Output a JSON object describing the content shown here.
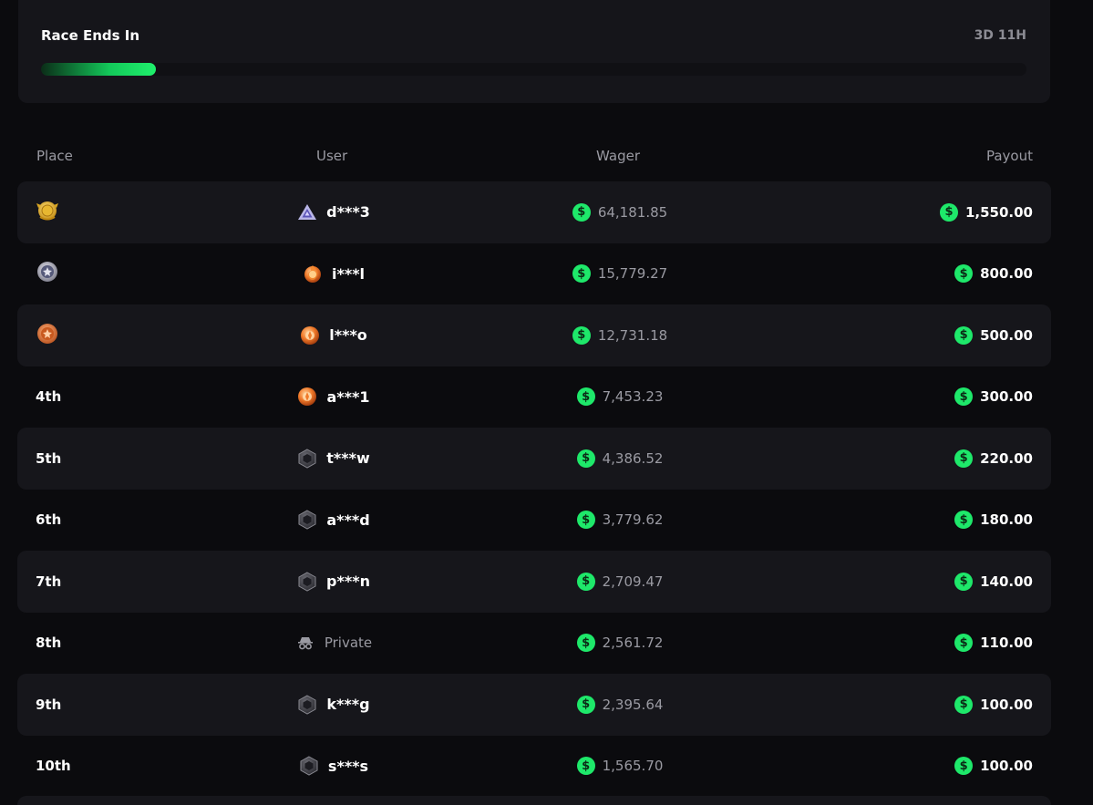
{
  "race": {
    "label": "Race Ends In",
    "time_left": "3D 11H",
    "progress_fraction": 0.117
  },
  "columns": {
    "place": "Place",
    "user": "User",
    "wager": "Wager",
    "payout": "Payout"
  },
  "colors": {
    "accent_green": "#1ee86a",
    "background": "#0b0b0e",
    "row_shade": "#16161b"
  },
  "rows": [
    {
      "place": "",
      "medal": "gold-medal-icon",
      "avatar": "purple-triangle-rank-icon",
      "user": "d***3",
      "wager": "64,181.85",
      "payout": "1,550.00"
    },
    {
      "place": "",
      "medal": "silver-medal-icon",
      "avatar": "orange-flame-rank-icon",
      "user": "i***l",
      "wager": "15,779.27",
      "payout": "800.00"
    },
    {
      "place": "",
      "medal": "bronze-medal-icon",
      "avatar": "orange-orb-rank-icon",
      "user": "l***o",
      "wager": "12,731.18",
      "payout": "500.00"
    },
    {
      "place": "4th",
      "avatar": "orange-orb-rank-icon",
      "user": "a***1",
      "wager": "7,453.23",
      "payout": "300.00"
    },
    {
      "place": "5th",
      "avatar": "gray-hexagon-rank-icon",
      "user": "t***w",
      "wager": "4,386.52",
      "payout": "220.00"
    },
    {
      "place": "6th",
      "avatar": "gray-hexagon-rank-icon",
      "user": "a***d",
      "wager": "3,779.62",
      "payout": "180.00"
    },
    {
      "place": "7th",
      "avatar": "gray-hexagon-rank-icon",
      "user": "p***n",
      "wager": "2,709.47",
      "payout": "140.00"
    },
    {
      "place": "8th",
      "avatar": "incognito-icon",
      "user": "Private",
      "wager": "2,561.72",
      "payout": "110.00"
    },
    {
      "place": "9th",
      "avatar": "gray-hexagon-rank-icon",
      "user": "k***g",
      "wager": "2,395.64",
      "payout": "100.00"
    },
    {
      "place": "10th",
      "avatar": "gray-hexagon-rank-icon",
      "user": "s***s",
      "wager": "1,565.70",
      "payout": "100.00"
    }
  ],
  "coin_symbol": "$"
}
